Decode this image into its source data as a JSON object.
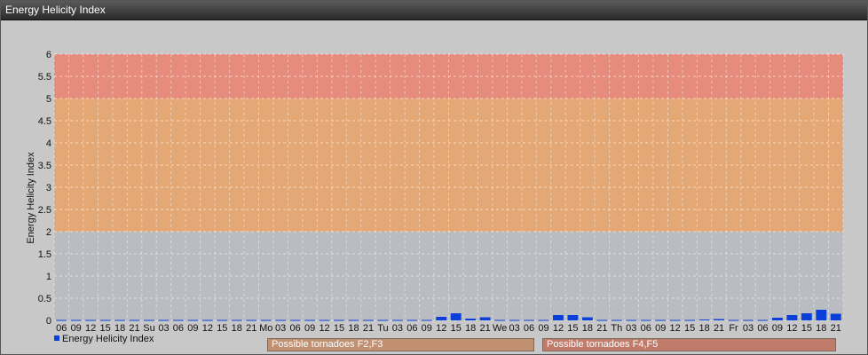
{
  "window": {
    "title": "Energy Helicity Index"
  },
  "legend": {
    "label": "Energy Helicity Index"
  },
  "zones": {
    "f2f3": "Possible tornadoes F2,F3",
    "f4f5": "Possible tornadoes F4,F5"
  },
  "colors": {
    "bar": "#0b3fd9",
    "band_low": "#b9bcc0",
    "band_mid": "#e4a877",
    "band_high": "#e58c7c",
    "frame_bg": "#c8c8c8"
  },
  "chart_data": {
    "type": "bar",
    "title": "",
    "xlabel": "",
    "ylabel": "Energy Helicity Index",
    "ylim": [
      0,
      6
    ],
    "yticks": [
      "0",
      "0.5",
      "1",
      "1.5",
      "2",
      "2.5",
      "3",
      "3.5",
      "4",
      "4.5",
      "5",
      "5.5",
      "6"
    ],
    "grid": true,
    "legend_position": "bottom-left",
    "bands": [
      {
        "from": 0,
        "to": 2,
        "color": "#b9bcc0"
      },
      {
        "from": 2,
        "to": 5,
        "color": "#e4a877"
      },
      {
        "from": 5,
        "to": 6,
        "color": "#e58c7c"
      }
    ],
    "categories": [
      "06",
      "09",
      "12",
      "15",
      "18",
      "21",
      "Su",
      "03",
      "06",
      "09",
      "12",
      "15",
      "18",
      "21",
      "Mo",
      "03",
      "06",
      "09",
      "12",
      "15",
      "18",
      "21",
      "Tu",
      "03",
      "06",
      "09",
      "12",
      "15",
      "18",
      "21",
      "We",
      "03",
      "06",
      "09",
      "12",
      "15",
      "18",
      "21",
      "Th",
      "03",
      "06",
      "09",
      "12",
      "15",
      "18",
      "21",
      "Fr",
      "03",
      "06",
      "09",
      "12",
      "15",
      "18",
      "21"
    ],
    "series": [
      {
        "values": [
          0.01,
          0.01,
          0.01,
          0.01,
          0.01,
          0.01,
          0.01,
          0.01,
          0.01,
          0.01,
          0.01,
          0.01,
          0.01,
          0.01,
          0.01,
          0.01,
          0.01,
          0.01,
          0.01,
          0.01,
          0.01,
          0.01,
          0.01,
          0.01,
          0.01,
          0.01,
          0.08,
          0.16,
          0.04,
          0.07,
          0.01,
          0.01,
          0.01,
          0.01,
          0.12,
          0.12,
          0.07,
          0.01,
          0.01,
          0.01,
          0.01,
          0.01,
          0.01,
          0.01,
          0.02,
          0.03,
          0.01,
          0.01,
          0.01,
          0.06,
          0.12,
          0.16,
          0.24,
          0.15
        ]
      }
    ]
  }
}
